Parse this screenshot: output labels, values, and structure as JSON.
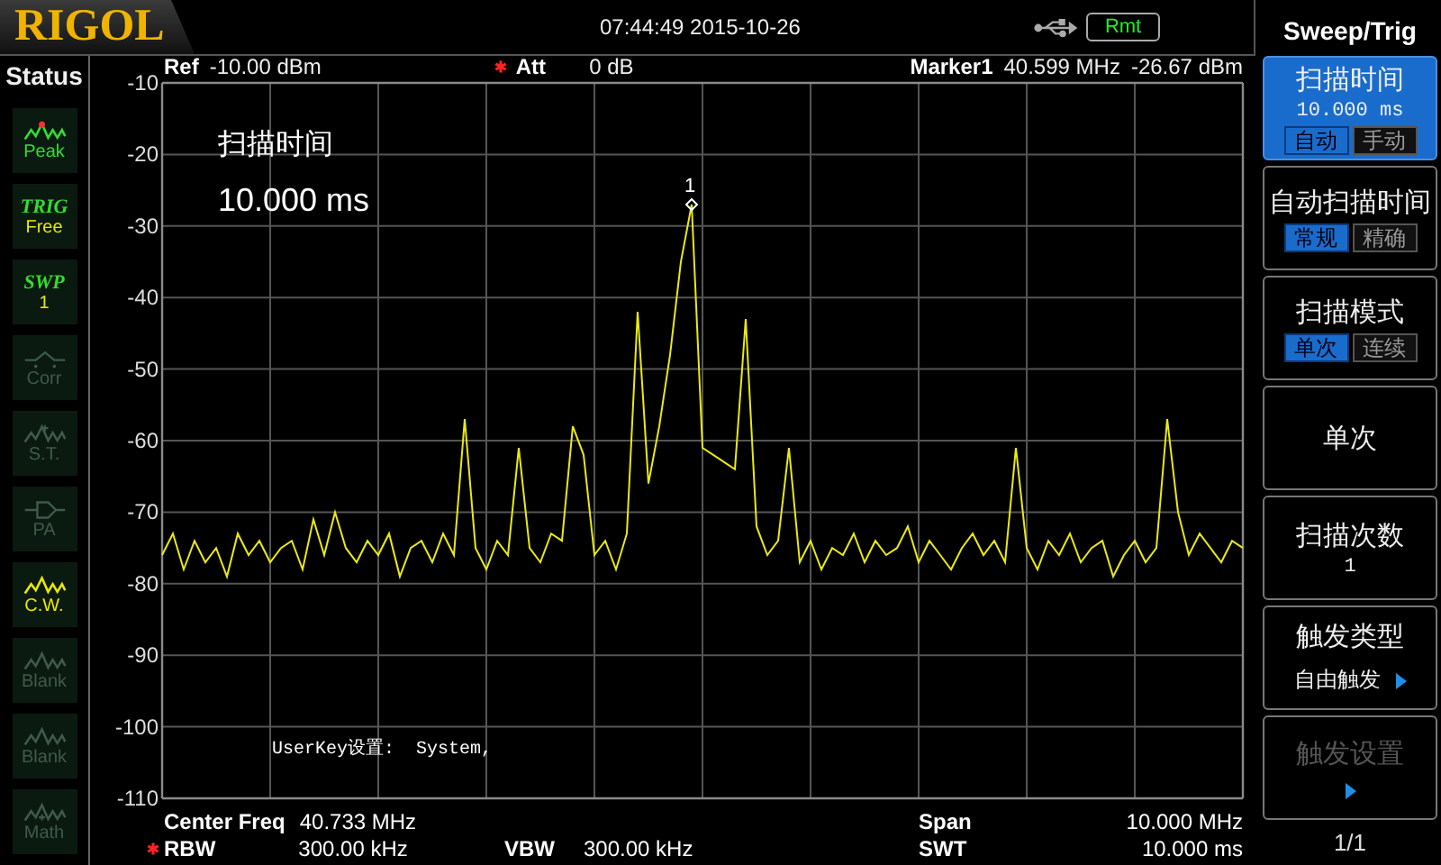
{
  "top_bar": {
    "brand": "RIGOL",
    "datetime": "07:44:49 2015-10-26",
    "remote_badge": "Rmt"
  },
  "status": {
    "title": "Status",
    "items": [
      {
        "kind": "peak",
        "label": "Peak",
        "on": true,
        "color": "#33dd33"
      },
      {
        "kind": "text",
        "tag": "TRIG",
        "label": "Free",
        "on": true,
        "color": "#e8e800"
      },
      {
        "kind": "text",
        "tag": "SWP",
        "label": "1",
        "on": true,
        "color": "#e8e800"
      },
      {
        "kind": "corr",
        "label": "Corr",
        "on": false
      },
      {
        "kind": "st",
        "label": "S.T.",
        "on": false
      },
      {
        "kind": "amp",
        "label": "PA",
        "on": false
      },
      {
        "kind": "wave",
        "label": "C.W.",
        "on": true,
        "color": "#e8e800"
      },
      {
        "kind": "wave",
        "label": "Blank",
        "on": false
      },
      {
        "kind": "wave",
        "label": "Blank",
        "on": false
      },
      {
        "kind": "math",
        "label": "Math",
        "on": false
      }
    ]
  },
  "header": {
    "ref_label": "Ref",
    "ref_value": "-10.00 dBm",
    "att_label": "Att",
    "att_flag": true,
    "att_value": "0 dB",
    "marker_label": "Marker1",
    "marker_freq": "40.599 MHz",
    "marker_level": "-26.67 dBm"
  },
  "plot": {
    "chart_data": {
      "type": "line",
      "grid": true,
      "ylim": [
        -110,
        -10
      ],
      "yticks": [
        -10,
        -20,
        -30,
        -40,
        -50,
        -60,
        -70,
        -80,
        -90,
        -100,
        -110
      ],
      "series": [
        {
          "color": "#eaea10",
          "values": [
            -76,
            -73,
            -78,
            -74,
            -77,
            -75,
            -79,
            -73,
            -76,
            -74,
            -77,
            -75,
            -74,
            -78,
            -71,
            -76,
            -70,
            -75,
            -77,
            -74,
            -76,
            -73,
            -79,
            -75,
            -74,
            -77,
            -73,
            -76,
            -57,
            -75,
            -78,
            -74,
            -76,
            -61,
            -75,
            -77,
            -73,
            -74,
            -58,
            -62,
            -76,
            -74,
            -78,
            -73,
            -42,
            -66,
            -58,
            -48,
            -35,
            -27,
            -61,
            -62,
            -63,
            -64,
            -43,
            -72,
            -76,
            -74,
            -61,
            -77,
            -74,
            -78,
            -75,
            -76,
            -73,
            -77,
            -74,
            -76,
            -75,
            -72,
            -77,
            -74,
            -76,
            -78,
            -75,
            -73,
            -76,
            -74,
            -77,
            -61,
            -75,
            -78,
            -74,
            -76,
            -73,
            -77,
            -75,
            -74,
            -79,
            -76,
            -74,
            -77,
            -75,
            -57,
            -70,
            -76,
            -73,
            -75,
            -77,
            -74,
            -75
          ]
        }
      ]
    },
    "marker_number": "1",
    "overlay_title": "扫描时间",
    "overlay_value": "10.000 ms",
    "userkey_note": "UserKey设置:  System,"
  },
  "footer": [
    {
      "label": "Center Freq",
      "value": "40.733 MHz",
      "flag": false
    },
    {
      "label": "Span",
      "value": "10.000 MHz",
      "flag": false
    },
    {
      "label": "RBW",
      "value": "300.00 kHz",
      "flag": true
    },
    {
      "label": "VBW",
      "value": "300.00 kHz",
      "flag": false
    },
    {
      "label": "SWT",
      "value": "10.000 ms",
      "flag": false
    }
  ],
  "menu": {
    "title": "Sweep/Trig",
    "page": "1/1",
    "items": [
      {
        "kind": "toggle",
        "label": "扫描时间",
        "value": "10.000 ms",
        "selected": true,
        "disabled": false,
        "options": [
          {
            "label": "自动",
            "selected": true
          },
          {
            "label": "手动",
            "selected": false
          }
        ]
      },
      {
        "kind": "toggle",
        "label": "自动扫描时间",
        "selected": false,
        "disabled": false,
        "options": [
          {
            "label": "常规",
            "selected": true
          },
          {
            "label": "精确",
            "selected": false
          }
        ]
      },
      {
        "kind": "toggle",
        "label": "扫描模式",
        "selected": false,
        "disabled": false,
        "options": [
          {
            "label": "单次",
            "selected": true
          },
          {
            "label": "连续",
            "selected": false
          }
        ]
      },
      {
        "kind": "plain",
        "label": "单次",
        "selected": false,
        "disabled": false
      },
      {
        "kind": "value",
        "label": "扫描次数",
        "value": "1",
        "selected": false,
        "disabled": false
      },
      {
        "kind": "submenu",
        "label": "触发类型",
        "value": "自由触发",
        "selected": false,
        "disabled": false
      },
      {
        "kind": "submenu",
        "label": "触发设置",
        "selected": false,
        "disabled": true
      }
    ]
  }
}
